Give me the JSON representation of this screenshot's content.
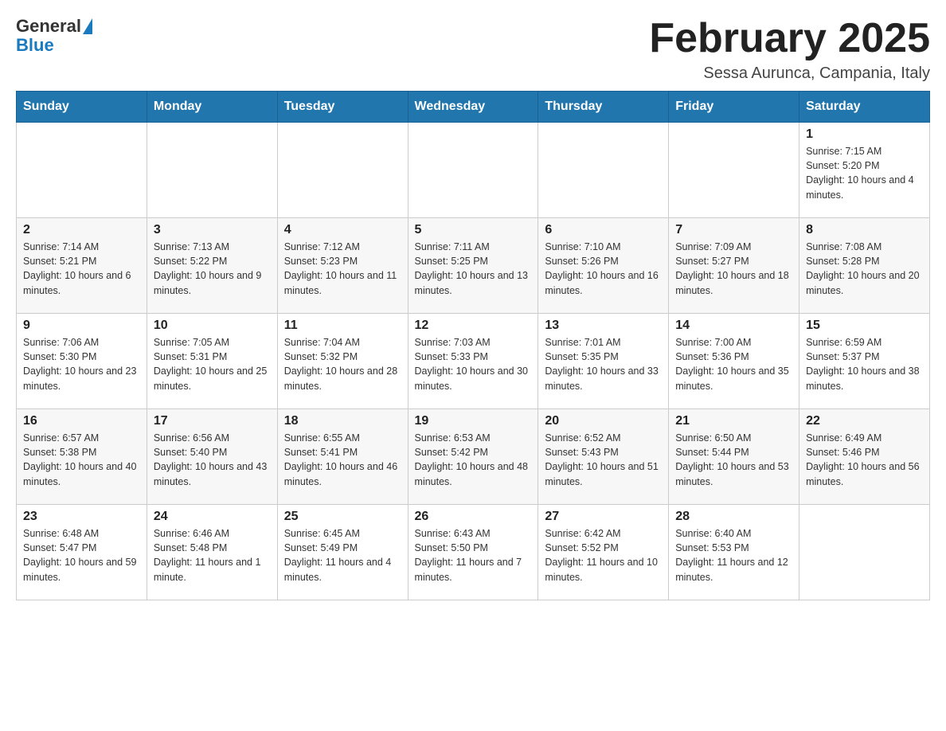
{
  "header": {
    "logo_general": "General",
    "logo_blue": "Blue",
    "month_title": "February 2025",
    "location": "Sessa Aurunca, Campania, Italy"
  },
  "weekdays": [
    "Sunday",
    "Monday",
    "Tuesday",
    "Wednesday",
    "Thursday",
    "Friday",
    "Saturday"
  ],
  "weeks": [
    [
      {
        "day": "",
        "info": ""
      },
      {
        "day": "",
        "info": ""
      },
      {
        "day": "",
        "info": ""
      },
      {
        "day": "",
        "info": ""
      },
      {
        "day": "",
        "info": ""
      },
      {
        "day": "",
        "info": ""
      },
      {
        "day": "1",
        "info": "Sunrise: 7:15 AM\nSunset: 5:20 PM\nDaylight: 10 hours and 4 minutes."
      }
    ],
    [
      {
        "day": "2",
        "info": "Sunrise: 7:14 AM\nSunset: 5:21 PM\nDaylight: 10 hours and 6 minutes."
      },
      {
        "day": "3",
        "info": "Sunrise: 7:13 AM\nSunset: 5:22 PM\nDaylight: 10 hours and 9 minutes."
      },
      {
        "day": "4",
        "info": "Sunrise: 7:12 AM\nSunset: 5:23 PM\nDaylight: 10 hours and 11 minutes."
      },
      {
        "day": "5",
        "info": "Sunrise: 7:11 AM\nSunset: 5:25 PM\nDaylight: 10 hours and 13 minutes."
      },
      {
        "day": "6",
        "info": "Sunrise: 7:10 AM\nSunset: 5:26 PM\nDaylight: 10 hours and 16 minutes."
      },
      {
        "day": "7",
        "info": "Sunrise: 7:09 AM\nSunset: 5:27 PM\nDaylight: 10 hours and 18 minutes."
      },
      {
        "day": "8",
        "info": "Sunrise: 7:08 AM\nSunset: 5:28 PM\nDaylight: 10 hours and 20 minutes."
      }
    ],
    [
      {
        "day": "9",
        "info": "Sunrise: 7:06 AM\nSunset: 5:30 PM\nDaylight: 10 hours and 23 minutes."
      },
      {
        "day": "10",
        "info": "Sunrise: 7:05 AM\nSunset: 5:31 PM\nDaylight: 10 hours and 25 minutes."
      },
      {
        "day": "11",
        "info": "Sunrise: 7:04 AM\nSunset: 5:32 PM\nDaylight: 10 hours and 28 minutes."
      },
      {
        "day": "12",
        "info": "Sunrise: 7:03 AM\nSunset: 5:33 PM\nDaylight: 10 hours and 30 minutes."
      },
      {
        "day": "13",
        "info": "Sunrise: 7:01 AM\nSunset: 5:35 PM\nDaylight: 10 hours and 33 minutes."
      },
      {
        "day": "14",
        "info": "Sunrise: 7:00 AM\nSunset: 5:36 PM\nDaylight: 10 hours and 35 minutes."
      },
      {
        "day": "15",
        "info": "Sunrise: 6:59 AM\nSunset: 5:37 PM\nDaylight: 10 hours and 38 minutes."
      }
    ],
    [
      {
        "day": "16",
        "info": "Sunrise: 6:57 AM\nSunset: 5:38 PM\nDaylight: 10 hours and 40 minutes."
      },
      {
        "day": "17",
        "info": "Sunrise: 6:56 AM\nSunset: 5:40 PM\nDaylight: 10 hours and 43 minutes."
      },
      {
        "day": "18",
        "info": "Sunrise: 6:55 AM\nSunset: 5:41 PM\nDaylight: 10 hours and 46 minutes."
      },
      {
        "day": "19",
        "info": "Sunrise: 6:53 AM\nSunset: 5:42 PM\nDaylight: 10 hours and 48 minutes."
      },
      {
        "day": "20",
        "info": "Sunrise: 6:52 AM\nSunset: 5:43 PM\nDaylight: 10 hours and 51 minutes."
      },
      {
        "day": "21",
        "info": "Sunrise: 6:50 AM\nSunset: 5:44 PM\nDaylight: 10 hours and 53 minutes."
      },
      {
        "day": "22",
        "info": "Sunrise: 6:49 AM\nSunset: 5:46 PM\nDaylight: 10 hours and 56 minutes."
      }
    ],
    [
      {
        "day": "23",
        "info": "Sunrise: 6:48 AM\nSunset: 5:47 PM\nDaylight: 10 hours and 59 minutes."
      },
      {
        "day": "24",
        "info": "Sunrise: 6:46 AM\nSunset: 5:48 PM\nDaylight: 11 hours and 1 minute."
      },
      {
        "day": "25",
        "info": "Sunrise: 6:45 AM\nSunset: 5:49 PM\nDaylight: 11 hours and 4 minutes."
      },
      {
        "day": "26",
        "info": "Sunrise: 6:43 AM\nSunset: 5:50 PM\nDaylight: 11 hours and 7 minutes."
      },
      {
        "day": "27",
        "info": "Sunrise: 6:42 AM\nSunset: 5:52 PM\nDaylight: 11 hours and 10 minutes."
      },
      {
        "day": "28",
        "info": "Sunrise: 6:40 AM\nSunset: 5:53 PM\nDaylight: 11 hours and 12 minutes."
      },
      {
        "day": "",
        "info": ""
      }
    ]
  ]
}
